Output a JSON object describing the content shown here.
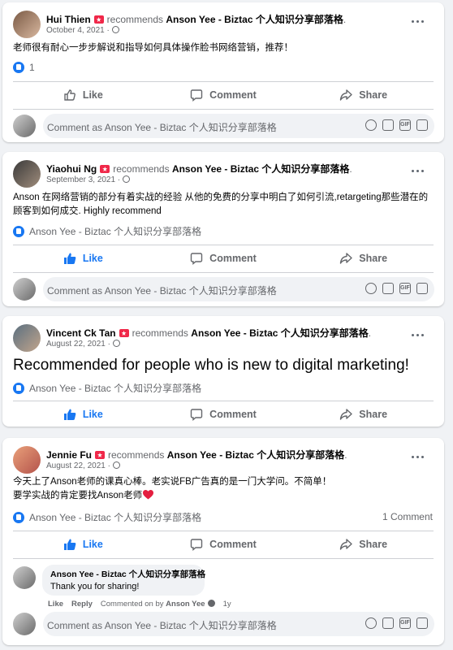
{
  "posts": [
    {
      "author": "Hui Thien",
      "recommends": "recommends",
      "page": "Anson Yee - Biztac 个人知识分享部落格",
      "date": "October 4, 2021 ·",
      "text": "老师很有耐心一步步解说和指导如何具体操作脸书网络营销，推荐！",
      "reactions": "1"
    },
    {
      "author": "Yiaohui Ng",
      "recommends": "recommends",
      "page": "Anson Yee - Biztac 个人知识分享部落格",
      "date": "September 3, 2021 ·",
      "text": "Anson 在网络营销的部分有着实战的经验 从他的免费的分享中明白了如何引流,retargeting那些潜在的顾客到如何成交. Highly recommend",
      "reactions": "Anson Yee - Biztac 个人知识分享部落格"
    },
    {
      "author": "Vincent Ck Tan",
      "recommends": "recommends",
      "page": "Anson Yee - Biztac 个人知识分享部落格",
      "date": "August 22, 2021 ·",
      "text": "Recommended for people who is new to digital marketing!",
      "reactions": "Anson Yee - Biztac 个人知识分享部落格"
    },
    {
      "author": "Jennie Fu",
      "recommends": "recommends",
      "page": "Anson Yee - Biztac 个人知识分享部落格",
      "date": "August 22, 2021 ·",
      "text_line1": "今天上了Anson老师的课真心棒。老实说FB广告真的是一门大学问。不简单！",
      "text_line2": "要学实战的肯定要找Anson老师",
      "reactions": "Anson Yee - Biztac 个人知识分享部落格",
      "comment_count": "1 Comment",
      "reply": {
        "name": "Anson Yee - Biztac 个人知识分享部落格",
        "text": "Thank you for sharing!",
        "like": "Like",
        "reply": "Reply",
        "commented_on_by": "Commented on by",
        "commented_by_name": "Anson Yee",
        "age": "1y"
      }
    }
  ],
  "actions": {
    "like": "Like",
    "comment": "Comment",
    "share": "Share"
  },
  "composer": {
    "placeholder": "Comment as Anson Yee - Biztac 个人知识分享部落格"
  },
  "colors": {
    "accent": "#1877f2",
    "badge": "#f02849",
    "secondary_text": "#65676b",
    "heart": "#e41e3f"
  }
}
